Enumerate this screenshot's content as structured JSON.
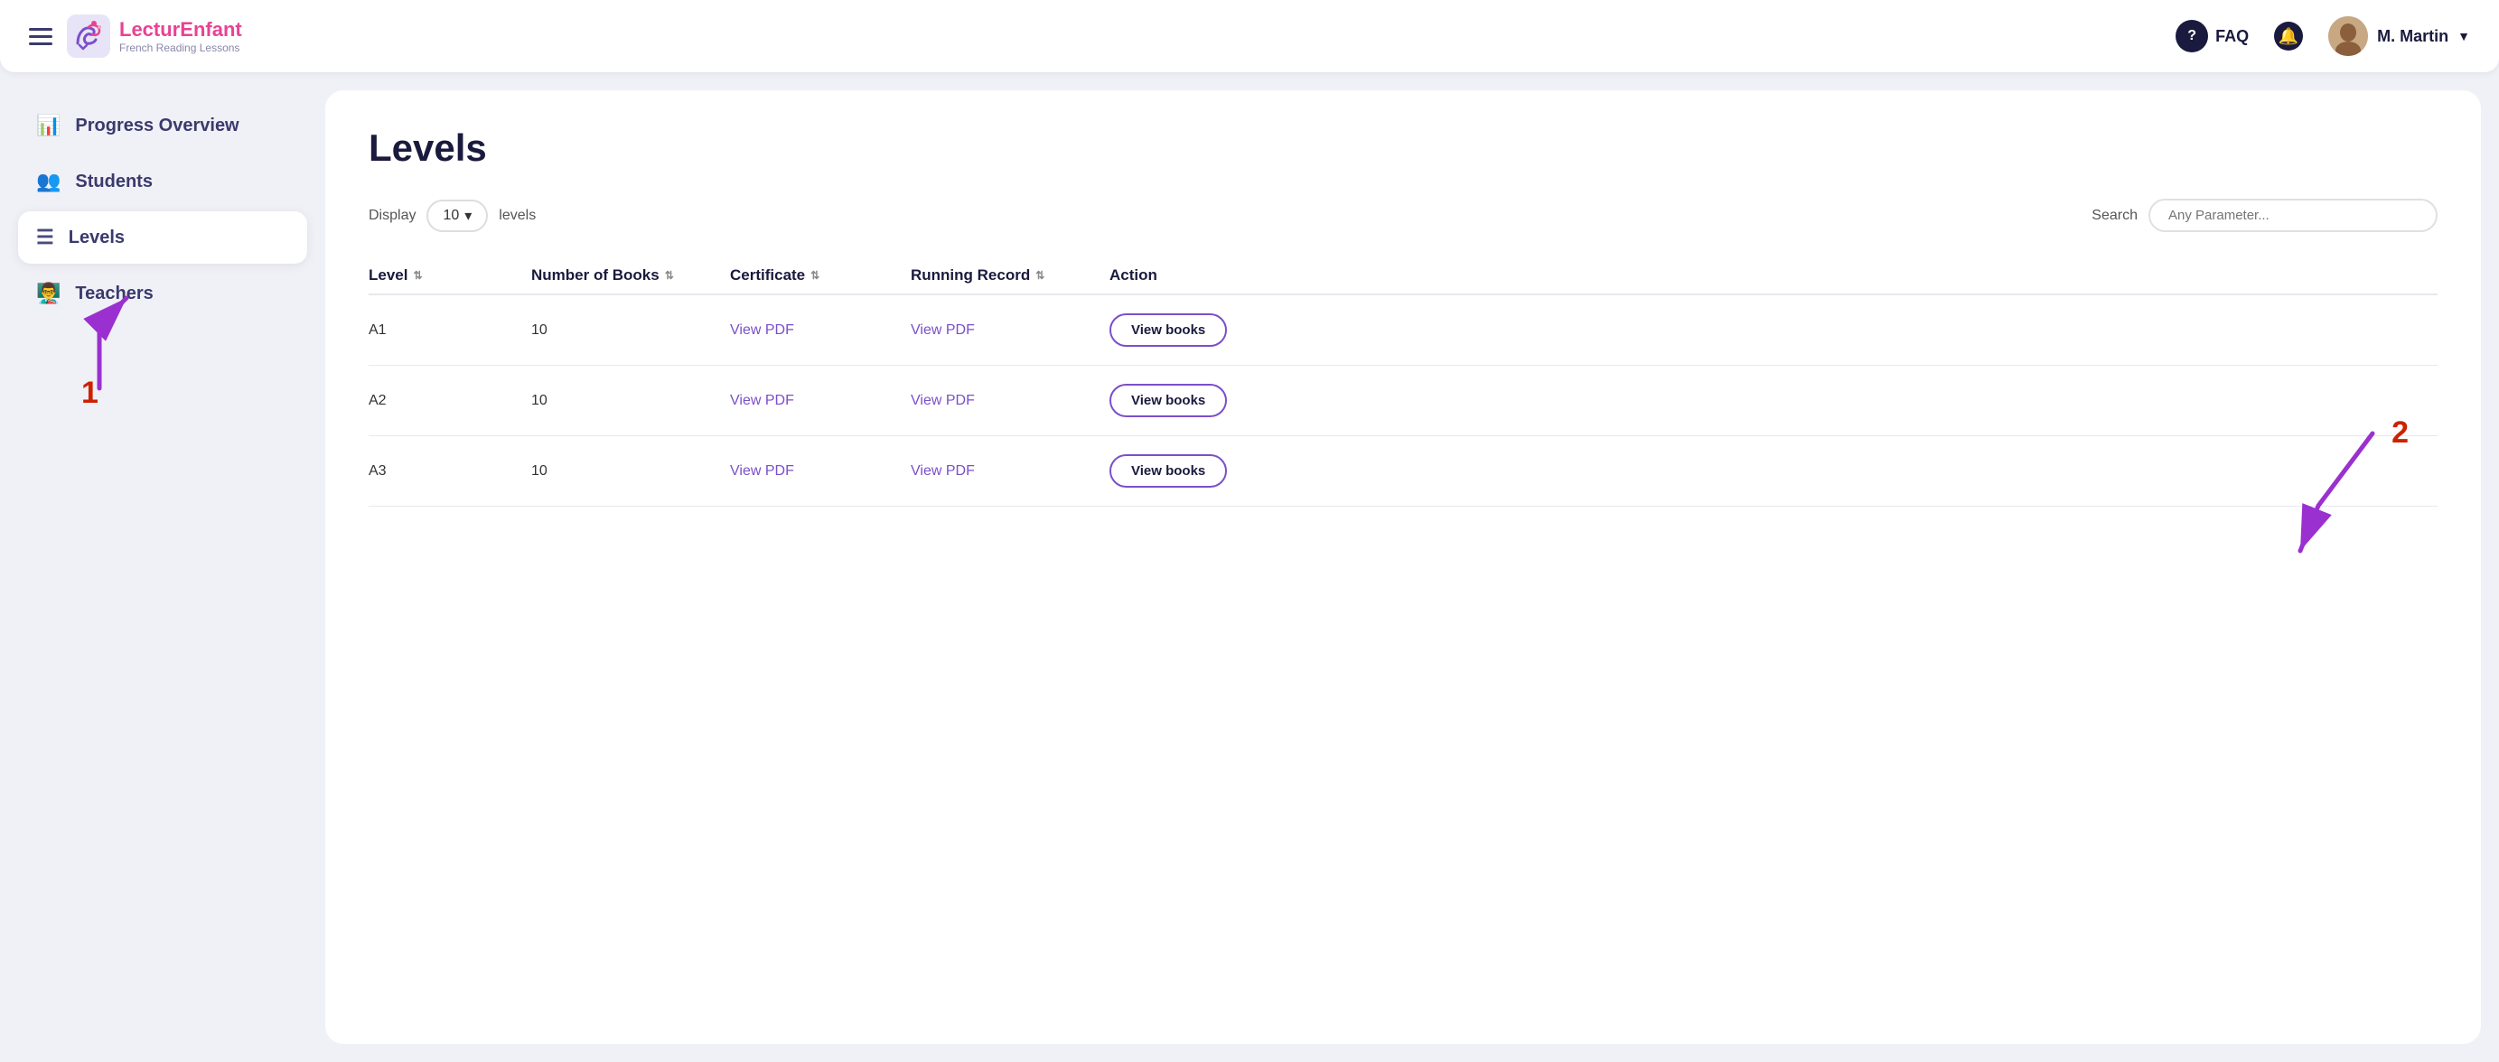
{
  "header": {
    "menu_label": "Menu",
    "logo_name_part1": "Lectur",
    "logo_name_highlight": "E",
    "logo_name_part2": "nfant",
    "logo_subtitle": "French Reading Lessons",
    "faq_label": "FAQ",
    "user_name": "M. Martin"
  },
  "sidebar": {
    "items": [
      {
        "id": "progress-overview",
        "label": "Progress Overview",
        "icon": "📊"
      },
      {
        "id": "students",
        "label": "Students",
        "icon": "👥"
      },
      {
        "id": "levels",
        "label": "Levels",
        "icon": "☰",
        "active": true
      },
      {
        "id": "teachers",
        "label": "Teachers",
        "icon": "👨‍🏫"
      }
    ]
  },
  "main": {
    "page_title": "Levels",
    "toolbar": {
      "display_label": "Display",
      "display_value": "10",
      "levels_label": "levels",
      "search_label": "Search",
      "search_placeholder": "Any Parameter..."
    },
    "table": {
      "columns": [
        {
          "id": "level",
          "label": "Level"
        },
        {
          "id": "num_books",
          "label": "Number of Books"
        },
        {
          "id": "certificate",
          "label": "Certificate"
        },
        {
          "id": "running_record",
          "label": "Running Record"
        },
        {
          "id": "action",
          "label": "Action"
        }
      ],
      "rows": [
        {
          "level": "A1",
          "num_books": "10",
          "certificate": "View PDF",
          "running_record": "View PDF",
          "action": "View books"
        },
        {
          "level": "A2",
          "num_books": "10",
          "certificate": "View PDF",
          "running_record": "View PDF",
          "action": "View books"
        },
        {
          "level": "A3",
          "num_books": "10",
          "certificate": "View PDF",
          "running_record": "View PDF",
          "action": "View books"
        }
      ]
    }
  },
  "annotations": {
    "arrow1_label": "1",
    "arrow2_label": "2"
  }
}
